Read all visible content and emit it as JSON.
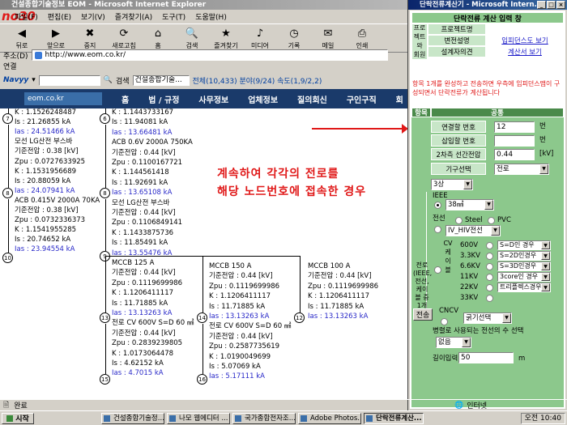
{
  "ie": {
    "title": "건설종합기술정보 EOM - Microsoft Internet Explorer",
    "overlay_logo": "no30",
    "menu": [
      "파일(F)",
      "편집(E)",
      "보기(V)",
      "즐겨찾기(A)",
      "도구(T)",
      "도움말(H)"
    ],
    "toolbar": [
      "뒤로",
      "앞으로",
      "중지",
      "새로고침",
      "홈",
      "검색",
      "즐겨찾기",
      "미디어",
      "기록",
      "메일",
      "인쇄"
    ],
    "address_label": "주소(D)",
    "address": "http://www.eom.co.kr/",
    "links_label": "연결",
    "navy": "Navyy",
    "search_label": "검색",
    "search_value": "건설종합기술...",
    "result_text": "전체(10,433)  분야(9/24)  속도(1,9/2,2)",
    "status": "완료",
    "zone": "인터넷"
  },
  "site": {
    "logo": "eom.co.kr",
    "nav": [
      "홈",
      "법 / 규정",
      "사무정보",
      "업체정보",
      "질의회신",
      "구인구직",
      "회"
    ]
  },
  "annotation": [
    "계속하여 각각의 전로를",
    "해당 노드번호에 접속한 경우"
  ],
  "left": [
    {
      "t": "K : 1.1526248487",
      "c": ""
    },
    {
      "t": "Is : 21.26855 kA",
      "c": ""
    },
    {
      "t": "Ias : 24.51466 kA",
      "c": "bl"
    },
    {
      "t": "모선 LG산전 부스바",
      "c": ""
    },
    {
      "t": "기준전압 : 0.38 [kV]",
      "c": ""
    },
    {
      "t": "Zpu : 0.0727633925",
      "c": ""
    },
    {
      "t": "K : 1.1531956689",
      "c": ""
    },
    {
      "t": "Is : 20.88059 kA",
      "c": ""
    },
    {
      "t": "Ias : 24.07941 kA",
      "c": "bl"
    },
    {
      "t": "ACB 0.415V 2000A 70KA",
      "c": ""
    },
    {
      "t": "기준전압 : 0.38 [kV]",
      "c": ""
    },
    {
      "t": "Zpu : 0.0732336373",
      "c": ""
    },
    {
      "t": "K : 1.1541955285",
      "c": ""
    },
    {
      "t": "Is : 20.74652 kA",
      "c": ""
    },
    {
      "t": "Ias : 23.94554 kA",
      "c": "bl"
    }
  ],
  "mid": [
    {
      "t": "K : 1.1443733167",
      "c": ""
    },
    {
      "t": "Is : 11.94081 kA",
      "c": ""
    },
    {
      "t": "Ias : 13.66481 kA",
      "c": "bl"
    },
    {
      "t": "ACB 0.6V 2000A 750KA",
      "c": ""
    },
    {
      "t": "기준전압 : 0.44 [kV]",
      "c": ""
    },
    {
      "t": "Zpu : 0.1100167721",
      "c": ""
    },
    {
      "t": "K : 1.144561418",
      "c": ""
    },
    {
      "t": "Is : 11.92691 kA",
      "c": ""
    },
    {
      "t": "Ias : 13.65108 kA",
      "c": "bl"
    },
    {
      "t": "모선 LG산전 부스바",
      "c": ""
    },
    {
      "t": "기준전압 : 0.44 [kV]",
      "c": ""
    },
    {
      "t": "Zpu : 0.1106849141",
      "c": ""
    },
    {
      "t": "K : 1.1433875736",
      "c": ""
    },
    {
      "t": "Is : 11.85491 kA",
      "c": ""
    },
    {
      "t": "Ias : 13.55476 kA",
      "c": "bl"
    },
    {
      "t": "MCCB 125 A",
      "c": ""
    },
    {
      "t": "기준전압 : 0.44 [kV]",
      "c": ""
    },
    {
      "t": "Zpu : 0.1119699986",
      "c": ""
    },
    {
      "t": "K : 1.1206411117",
      "c": ""
    },
    {
      "t": "Is : 11.71885 kA",
      "c": ""
    },
    {
      "t": "Ias : 13.13263 kA",
      "c": "bl"
    },
    {
      "t": "전로 CV 600V S=D 60 ㎟",
      "c": ""
    },
    {
      "t": "기준전압 : 0.44 [kV]",
      "c": ""
    },
    {
      "t": "Zpu : 0.2839239805",
      "c": ""
    },
    {
      "t": "K : 1.0173064478",
      "c": ""
    },
    {
      "t": "Is : 4.62152 kA",
      "c": ""
    },
    {
      "t": "Ias : 4.7015 kA",
      "c": "bl"
    }
  ],
  "b14": [
    {
      "t": "MCCB 150 A",
      "c": ""
    },
    {
      "t": "기준전압 : 0.44 [kV]",
      "c": ""
    },
    {
      "t": "Zpu : 0.1119699986",
      "c": ""
    },
    {
      "t": "K : 1.1206411117",
      "c": ""
    },
    {
      "t": "Is : 11.71885 kA",
      "c": ""
    },
    {
      "t": "Ias : 13.13263 kA",
      "c": "bl"
    },
    {
      "t": "전로 CV 600V S=D 60 ㎟",
      "c": ""
    },
    {
      "t": "기준전압 : 0.44 [kV]",
      "c": ""
    },
    {
      "t": "Zpu : 0.2587735619",
      "c": ""
    },
    {
      "t": "K : 1.0190049699",
      "c": ""
    },
    {
      "t": "Is : 5.07069 kA",
      "c": ""
    },
    {
      "t": "Ias : 5.17111 kA",
      "c": "bl"
    }
  ],
  "b12": [
    {
      "t": "MCCB 100 A",
      "c": ""
    },
    {
      "t": "기준전압 : 0.44 [kV]",
      "c": ""
    },
    {
      "t": "Zpu : 0.1119699986",
      "c": ""
    },
    {
      "t": "K : 1.1206411117",
      "c": ""
    },
    {
      "t": "Is : 11.71885 kA",
      "c": ""
    },
    {
      "t": "Ias : 13.13263 kA",
      "c": "bl"
    }
  ],
  "nodes": {
    "n7": "7",
    "n8": "8",
    "n10": "10",
    "n6": "6",
    "n8b": "8",
    "n9": "9",
    "n13": "13",
    "n15": "15",
    "n14": "14",
    "n16": "16",
    "n12": "12"
  },
  "popup": {
    "title": "단락전류계산기 - Microsoft Intern...",
    "heading": "단락전류 계산 입력 창",
    "side": "프로젝트와 회원용",
    "rows": [
      "프로젝트명",
      "변전설명",
      "설계자의견"
    ],
    "link1": "입피던스도 보기",
    "link2": "계산서 보기",
    "notice": "항목 1개를 완성하고 전송하면 우측에 임피던스맵이 구성되면서 단락전류가 계산됩니다",
    "col_item": "항목",
    "col_common": "공통",
    "fields": [
      {
        "label": "연결할 번호",
        "value": "12",
        "unit": "번"
      },
      {
        "label": "삽입할 번호",
        "value": "",
        "unit": "번"
      },
      {
        "label": "2차측 선간전압",
        "value": "0.44",
        "unit": "[kV]"
      }
    ],
    "equip_label": "기구선택",
    "equip_value": "전로",
    "sel_3phase": "3상",
    "ieee_label": "IEEE",
    "ieee_value": "38㎟",
    "cable_label": "전선",
    "steel": "Steel",
    "pvc": "PVC",
    "cable_type": "IV_HIV전선",
    "path_label": "전로 (IEEE, 전선, 케이블 중 1개 선택)",
    "cv_label": "CV 케이블",
    "volts": [
      "600V",
      "3.3KV",
      "6.6KV",
      "11KV",
      "22KV",
      "33KV"
    ],
    "drops": [
      "S=D인 경우",
      "S=2D인경우",
      "S=3D인경우",
      "3core인 경우",
      "트리플렉스경우"
    ],
    "send": "전송",
    "cncv": "CNCV",
    "cncv_value": "굵기선택",
    "parallel_label": "병렬로 사용되는 전선의 수 선택",
    "parallel_value": "없음",
    "length_label": "길이입력",
    "length_value": "50",
    "length_unit": "m"
  },
  "taskbar": {
    "start": "시작",
    "tasks": [
      "건설종합기술정...",
      "나모 웹에디터 ...",
      "국가종합전자조...",
      "Adobe Photos...",
      "단락전류계산..."
    ],
    "clock": "오전 10:40"
  }
}
